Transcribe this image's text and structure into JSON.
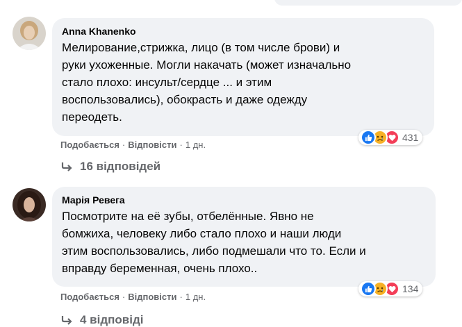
{
  "comments": [
    {
      "author": "Anna Khanenko",
      "text_lines": [
        "Мелирование,стрижка, лицо (в том числе брови) и",
        "руки ухоженные. Могли накачать (может изначально",
        "стало плохо: инсульт/сердце ... и этим",
        "воспользовались), обокрасть и даже одежду",
        "переодеть."
      ],
      "reactions": [
        "like-icon",
        "sad-icon",
        "love-icon"
      ],
      "reaction_count": "431",
      "like_label": "Подобається",
      "reply_label": "Відповісти",
      "time": "1 дн.",
      "replies_label": "16 відповідей"
    },
    {
      "author": "Марія Ревега",
      "text_lines": [
        "Посмотрите на её зубы, отбелённые. Явно не",
        "бомжиха, человеку либо стало плохо и наши люди",
        "этим воспользовались, либо подмешали что то. Если и",
        "вправду беременная, очень плохо.."
      ],
      "reactions": [
        "like-icon",
        "sad-icon",
        "love-icon"
      ],
      "reaction_count": "134",
      "like_label": "Подобається",
      "reply_label": "Відповісти",
      "time": "1 дн.",
      "replies_label": "4 відповіді"
    }
  ],
  "colors": {
    "bubble": "#f0f2f5",
    "text": "#050505",
    "secondary": "#65676b",
    "like": "#1877f2",
    "sad": "#f7b125",
    "love": "#f33e58"
  }
}
